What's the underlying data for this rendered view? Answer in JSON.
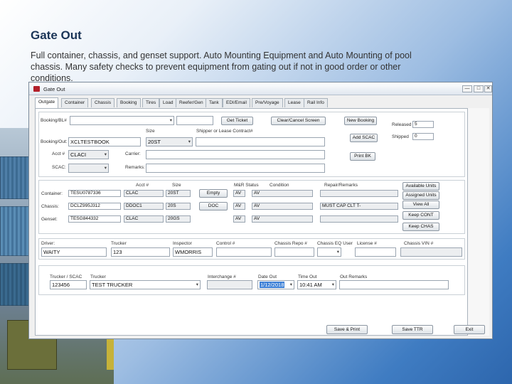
{
  "slide": {
    "title": "Gate Out",
    "text": "Full container, chassis, and genset support. Auto Mounting Equipment and Auto Mounting of pool chassis. Many safety checks to prevent equipment from gating out if not in good order or other conditions."
  },
  "window": {
    "title": "Gate Out",
    "controls": {
      "minimize": "—",
      "maximize": "□",
      "close": "✕"
    }
  },
  "tabs": [
    "Outgate",
    "Container",
    "Chassis",
    "Booking",
    "Tires",
    "Load",
    "Reefer/Gen",
    "Tank",
    "EDI/Email",
    "Pre/Voyage",
    "Lease",
    "Rail Info"
  ],
  "booking": {
    "booking_bl_label": "Booking/BL#",
    "booking_bl_value": "",
    "second_value": "",
    "get_ticket": "Get Ticket",
    "clear_cancel": "Clear/Cancel Screen",
    "new_booking": "New Booking",
    "add_scac": "Add SCAC",
    "print_bk": "Print BK",
    "released_label": "Released",
    "released_value": "5",
    "shipped_label": "Shipped",
    "shipped_value": "0",
    "size_label": "Size",
    "size_value": "20ST",
    "shipper_label": "Shipper or Lease Contract#",
    "shipper_value": "",
    "booking_out_label": "Booking/Out:",
    "booking_out_value": "XCLTESTBOOK",
    "acct_label": "Acct #",
    "acct_value": "CLACI",
    "scac_label": "SCAC:",
    "scac_value": "",
    "carrier_label": "Carrier:",
    "carrier_value": "",
    "remarks_label": "Remarks:",
    "remarks_value": ""
  },
  "equipment": {
    "headers": {
      "acct": "Acct #",
      "size": "Size",
      "mr_status": "M&R Status",
      "condition": "Condition",
      "repair": "Repair/Remarks"
    },
    "rows": [
      {
        "label": "Container:",
        "number": "TESU0787336",
        "acct": "CLAC",
        "size": "20ST",
        "action": "Empty",
        "mr": "AV",
        "cond": "AV",
        "repair": "",
        "side_button": "Available Units"
      },
      {
        "label": "Chassis:",
        "number": "DCLZ995J312",
        "acct": "DDOC1",
        "size": "20S",
        "action": "DOC",
        "mr": "AV",
        "cond": "AV",
        "repair": "MUST CAP CLT T-",
        "side_button": "Assigned Units"
      },
      {
        "label": "Genset:",
        "number": "TESG844332",
        "acct": "CLAC",
        "size": "20GS",
        "action": "",
        "mr": "AV",
        "cond": "AV",
        "repair": "",
        "side_button": "View All"
      }
    ],
    "keep_cont": "Keep CONT",
    "keep_chas": "Keep CHAS"
  },
  "people": {
    "driver_label": "Driver:",
    "driver_value": "WAITY",
    "trucker_label": "Trucker",
    "trucker_value": "123",
    "inspector_label": "Inspector",
    "inspector_value": "WMORRIS",
    "control_label": "Control #",
    "control_value": "",
    "chassis_repo_label": "Chassis Repo #",
    "chassis_repo_value": "",
    "chassis_eq_label": "Chassis EQ User",
    "chassis_eq_value": "",
    "license_label": "License #",
    "license_value": "",
    "chassis_vin_label": "Chassis VIN #",
    "chassis_vin_value": ""
  },
  "gate": {
    "trucker_scac_label": "Trucker / SCAC",
    "trucker_scac_value": "123456",
    "trucker_label": "Trucker",
    "trucker_value": "TEST TRUCKER",
    "interchange_label": "Interchange #",
    "interchange_value": "",
    "date_out_label": "Date Out",
    "date_out_value": "1/12/2018",
    "time_out_label": "Time Out",
    "time_out_value": "10:41 AM",
    "out_remarks_label": "Out Remarks",
    "out_remarks_value": ""
  },
  "footer": {
    "save_print": "Save & Print",
    "save_ttr": "Save TTR",
    "exit": "Exit"
  }
}
